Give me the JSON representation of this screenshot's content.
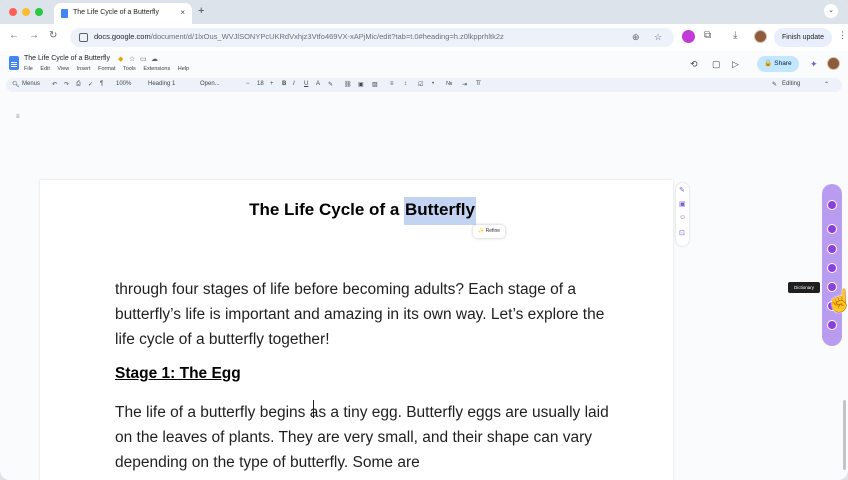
{
  "browser": {
    "tab_title": "The Life Cycle of a Butterfly",
    "tab_close": "×",
    "new_tab": "+",
    "url_host": "docs.google.com",
    "url_path": "/document/d/1lxOus_WVJlSONYPcUKRdVxhjz3Vtfo469VX-xAPjMic/edit?tab=t.0#heading=h.z0lkpprhltk2z",
    "finish_update": "Finish update"
  },
  "docs": {
    "title": "The Life Cycle of a Butterfly",
    "menu": [
      "File",
      "Edit",
      "View",
      "Insert",
      "Format",
      "Tools",
      "Extensions",
      "Help"
    ],
    "share_label": "Share",
    "toolbar": {
      "search": "Menus",
      "zoom": "100%",
      "style": "Heading 1",
      "font": "Open...",
      "font_size": "18",
      "editing": "Editing"
    }
  },
  "document": {
    "heading_before": "The Life Cycle of a ",
    "heading_highlight": "Butterfly",
    "refine_label": "Refine",
    "paragraph_1": "through four stages of life before becoming adults? Each stage of a butterfly’s life is important and amazing in its own way. Let’s explore the life cycle of a butterfly together!",
    "stage_heading": "Stage 1: The Egg",
    "paragraph_2": "The life of a butterfly begins as a tiny egg. Butterfly eggs are usually laid on the leaves of plants. They are very small, and their shape can vary depending on the type of butterfly. Some are"
  },
  "extension": {
    "tooltip": "Dictionary"
  },
  "colors": {
    "accent": "#8b3fe0",
    "highlight": "#c2d4f2",
    "share": "#c2e7ff"
  }
}
